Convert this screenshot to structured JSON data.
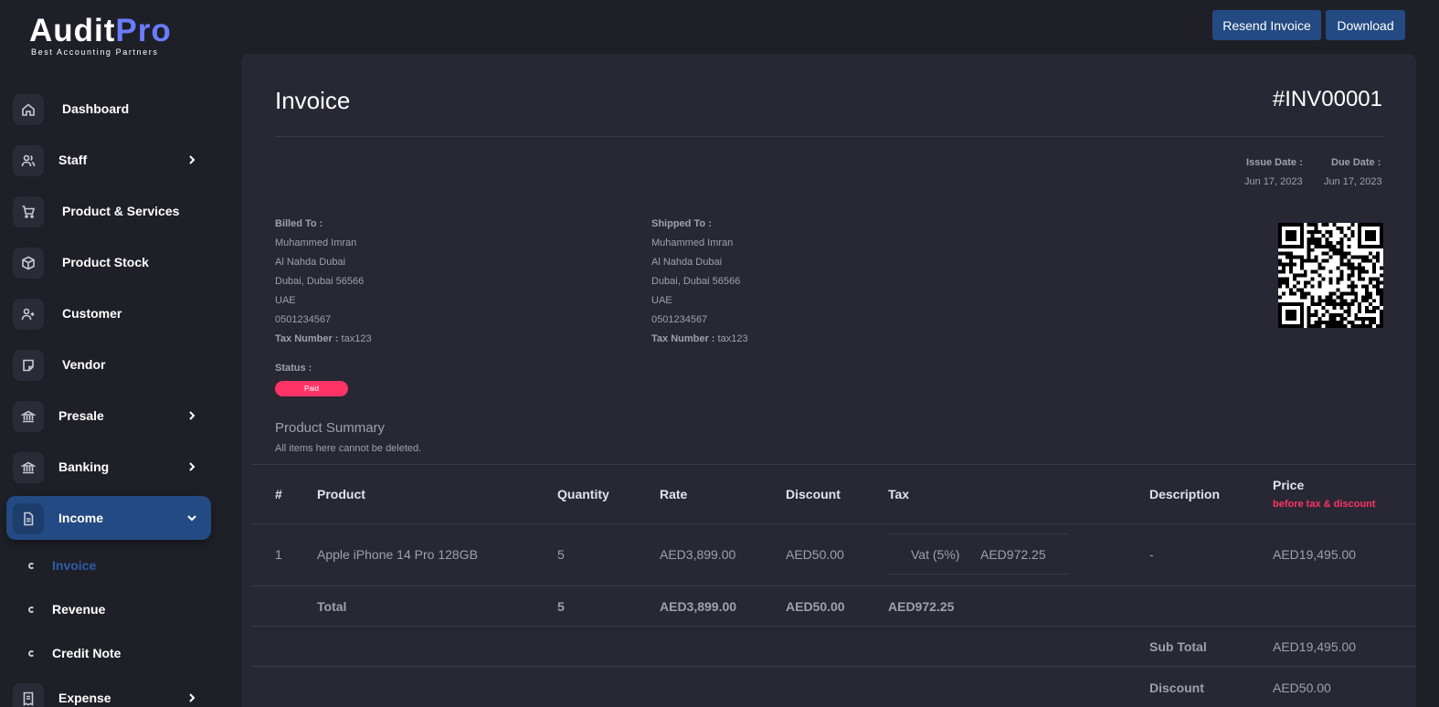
{
  "brand": {
    "name_a": "Audit",
    "name_b": "Pro",
    "tagline": "Best Accounting Partners"
  },
  "sidebar": {
    "items": [
      {
        "label": "Dashboard",
        "icon": "home-icon"
      },
      {
        "label": "Staff",
        "icon": "users-icon"
      },
      {
        "label": "Product & Services",
        "icon": "cart-icon"
      },
      {
        "label": "Product Stock",
        "icon": "box-icon"
      },
      {
        "label": "Customer",
        "icon": "user-plus-icon"
      },
      {
        "label": "Vendor",
        "icon": "note-icon"
      },
      {
        "label": "Presale",
        "icon": "bank-icon"
      },
      {
        "label": "Banking",
        "icon": "bank-icon"
      },
      {
        "label": "Income",
        "icon": "file-icon"
      },
      {
        "label": "Expense",
        "icon": "receipt-icon"
      }
    ],
    "income_sub": [
      "Invoice",
      "Revenue",
      "Credit Note"
    ]
  },
  "toolbar": {
    "resend_label": "Resend Invoice",
    "download_label": "Download"
  },
  "invoice": {
    "title": "Invoice",
    "number": "#INV00001",
    "issue_date_label": "Issue Date :",
    "issue_date": "Jun 17, 2023",
    "due_date_label": "Due Date :",
    "due_date": "Jun 17, 2023",
    "billed": {
      "heading": "Billed To :",
      "name": "Muhammed Imran",
      "line1": "Al Nahda Dubai",
      "line2": "Dubai, Dubai 56566",
      "country": "UAE",
      "phone": "0501234567",
      "tax_label": "Tax Number :",
      "tax_value": " tax123"
    },
    "shipped": {
      "heading": "Shipped To :",
      "name": "Muhammed Imran",
      "line1": "Al Nahda Dubai",
      "line2": "Dubai, Dubai 56566",
      "country": "UAE",
      "phone": "0501234567",
      "tax_label": "Tax Number :",
      "tax_value": " tax123"
    },
    "status_label": "Status :",
    "status": "Paid",
    "summary_title": "Product Summary",
    "summary_note": "All items here cannot be deleted.",
    "columns": {
      "num": "#",
      "product": "Product",
      "quantity": "Quantity",
      "rate": "Rate",
      "discount": "Discount",
      "tax": "Tax",
      "description": "Description",
      "price": "Price",
      "price_note": "before tax & discount"
    },
    "row": {
      "num": "1",
      "product": "Apple iPhone 14 Pro 128GB",
      "quantity": "5",
      "rate": "AED3,899.00",
      "discount": "AED50.00",
      "tax_name": "Vat (5%)",
      "tax_value": "AED972.25",
      "description": "-",
      "price": "AED19,495.00"
    },
    "total": {
      "label": "Total",
      "quantity": "5",
      "rate": "AED3,899.00",
      "discount": "AED50.00",
      "tax": "AED972.25"
    },
    "sub_total_label": "Sub Total",
    "sub_total": "AED19,495.00",
    "discount_label": "Discount",
    "discount_total": "AED50.00"
  },
  "colors": {
    "accent": "#234a82",
    "status_paid": "#ff3366",
    "brand_pro": "#6b7cff"
  }
}
